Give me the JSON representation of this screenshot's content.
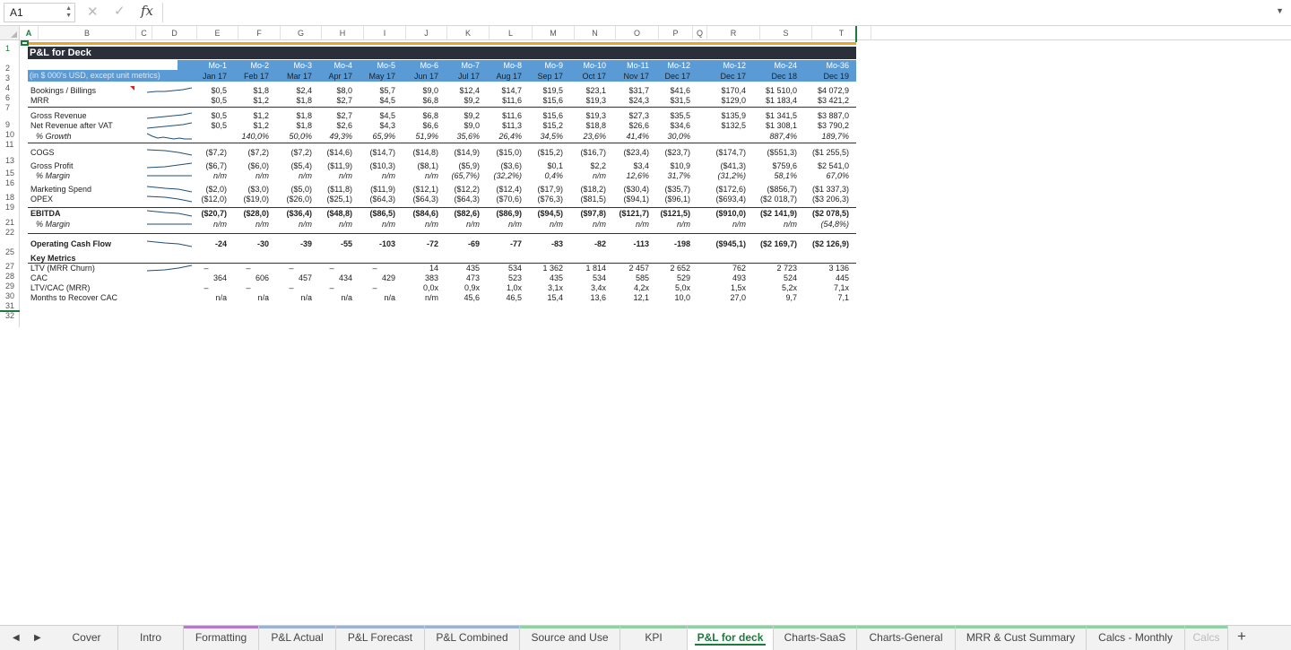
{
  "formula_bar": {
    "cell_ref": "A1",
    "fx_label": "fx",
    "cancel_icon": "✕",
    "enter_icon": "✓",
    "value": ""
  },
  "columns": [
    {
      "label": "A",
      "sel": true
    },
    {
      "label": "B"
    },
    {
      "label": "C"
    },
    {
      "label": "D"
    },
    {
      "label": "E"
    },
    {
      "label": "F"
    },
    {
      "label": "G"
    },
    {
      "label": "H"
    },
    {
      "label": "I"
    },
    {
      "label": "J"
    },
    {
      "label": "K"
    },
    {
      "label": "L"
    },
    {
      "label": "M"
    },
    {
      "label": "N"
    },
    {
      "label": "O"
    },
    {
      "label": "P"
    },
    {
      "label": "Q"
    },
    {
      "label": "R"
    },
    {
      "label": "S"
    },
    {
      "label": "T"
    }
  ],
  "row_numbers": [
    "1",
    "2",
    "3",
    "4",
    "6",
    "7",
    "9",
    "10",
    "11",
    "13",
    "15",
    "16",
    "18",
    "19",
    "21",
    "22",
    "25",
    "27",
    "28",
    "29",
    "30",
    "31",
    "32"
  ],
  "sheet": {
    "title": "P&L for Deck",
    "units": "(in $ 000's USD, except unit metrics)",
    "month_labels": [
      "Mo-1",
      "Mo-2",
      "Mo-3",
      "Mo-4",
      "Mo-5",
      "Mo-6",
      "Mo-7",
      "Mo-8",
      "Mo-9",
      "Mo-10",
      "Mo-11",
      "Mo-12",
      "Mo-12",
      "Mo-24",
      "Mo-36"
    ],
    "date_labels": [
      "Jan 17",
      "Feb 17",
      "Mar 17",
      "Apr 17",
      "May 17",
      "Jun 17",
      "Jul 17",
      "Aug 17",
      "Sep 17",
      "Oct 17",
      "Nov 17",
      "Dec 17",
      "Dec 17",
      "Dec 18",
      "Dec 19"
    ],
    "rows": [
      {
        "label": "Bookings / Billings",
        "spark": true,
        "values": [
          "$0,5",
          "$1,8",
          "$2,4",
          "$8,0",
          "$5,7",
          "$9,0",
          "$12,4",
          "$14,7",
          "$19,5",
          "$23,1",
          "$31,7",
          "$41,6",
          "$170,4",
          "$1 510,0",
          "$4 072,9"
        ]
      },
      {
        "label": "MRR",
        "values": [
          "$0,5",
          "$1,2",
          "$1,8",
          "$2,7",
          "$4,5",
          "$6,8",
          "$9,2",
          "$11,6",
          "$15,6",
          "$19,3",
          "$24,3",
          "$31,5",
          "$129,0",
          "$1 183,4",
          "$3 421,2"
        ]
      },
      {
        "label": "Gross Revenue",
        "spark": true,
        "values": [
          "$0,5",
          "$1,2",
          "$1,8",
          "$2,7",
          "$4,5",
          "$6,8",
          "$9,2",
          "$11,6",
          "$15,6",
          "$19,3",
          "$27,3",
          "$35,5",
          "$135,9",
          "$1 341,5",
          "$3 887,0"
        ]
      },
      {
        "label": "Net Revenue after VAT",
        "spark": true,
        "values": [
          "$0,5",
          "$1,2",
          "$1,8",
          "$2,6",
          "$4,3",
          "$6,6",
          "$9,0",
          "$11,3",
          "$15,2",
          "$18,8",
          "$26,6",
          "$34,6",
          "$132,5",
          "$1 308,1",
          "$3 790,2"
        ]
      },
      {
        "label": "% Growth",
        "indent": true,
        "italic": true,
        "spark": true,
        "values": [
          "",
          "140,0%",
          "50,0%",
          "49,3%",
          "65,9%",
          "51,9%",
          "35,6%",
          "26,4%",
          "34,5%",
          "23,6%",
          "41,4%",
          "30,0%",
          "",
          "887,4%",
          "189,7%"
        ]
      },
      {
        "label": "COGS",
        "spark": true,
        "values": [
          "($7,2)",
          "($7,2)",
          "($7,2)",
          "($14,6)",
          "($14,7)",
          "($14,8)",
          "($14,9)",
          "($15,0)",
          "($15,2)",
          "($16,7)",
          "($23,4)",
          "($23,7)",
          "($174,7)",
          "($551,3)",
          "($1 255,5)"
        ]
      },
      {
        "label": "Gross Profit",
        "spark": true,
        "values": [
          "($6,7)",
          "($6,0)",
          "($5,4)",
          "($11,9)",
          "($10,3)",
          "($8,1)",
          "($5,9)",
          "($3,6)",
          "$0,1",
          "$2,2",
          "$3,4",
          "$10,9",
          "($41,3)",
          "$759,6",
          "$2 541,0"
        ]
      },
      {
        "label": "% Margin",
        "indent": true,
        "italic": true,
        "spark": true,
        "values": [
          "n/m",
          "n/m",
          "n/m",
          "n/m",
          "n/m",
          "n/m",
          "(65,7%)",
          "(32,2%)",
          "0,4%",
          "n/m",
          "12,6%",
          "31,7%",
          "(31,2%)",
          "58,1%",
          "67,0%"
        ]
      },
      {
        "label": "Marketing Spend",
        "spark": true,
        "values": [
          "($2,0)",
          "($3,0)",
          "($5,0)",
          "($11,8)",
          "($11,9)",
          "($12,1)",
          "($12,2)",
          "($12,4)",
          "($17,9)",
          "($18,2)",
          "($30,4)",
          "($35,7)",
          "($172,6)",
          "($856,7)",
          "($1 337,3)"
        ]
      },
      {
        "label": "OPEX",
        "spark": true,
        "values": [
          "($12,0)",
          "($19,0)",
          "($26,0)",
          "($25,1)",
          "($64,3)",
          "($64,3)",
          "($64,3)",
          "($70,6)",
          "($76,3)",
          "($81,5)",
          "($94,1)",
          "($96,1)",
          "($693,4)",
          "($2 018,7)",
          "($3 206,3)"
        ]
      },
      {
        "label": "EBITDA",
        "bold": true,
        "spark": true,
        "values": [
          "($20,7)",
          "($28,0)",
          "($36,4)",
          "($48,8)",
          "($86,5)",
          "($84,6)",
          "($82,6)",
          "($86,9)",
          "($94,5)",
          "($97,8)",
          "($121,7)",
          "($121,5)",
          "($910,0)",
          "($2 141,9)",
          "($2 078,5)"
        ]
      },
      {
        "label": "% Margin",
        "indent": true,
        "italic": true,
        "spark": true,
        "values": [
          "n/m",
          "n/m",
          "n/m",
          "n/m",
          "n/m",
          "n/m",
          "n/m",
          "n/m",
          "n/m",
          "n/m",
          "n/m",
          "n/m",
          "n/m",
          "n/m",
          "(54,8%)"
        ]
      },
      {
        "label": "Operating Cash Flow",
        "bold": true,
        "spark": true,
        "values": [
          "-24",
          "-30",
          "-39",
          "-55",
          "-103",
          "-72",
          "-69",
          "-77",
          "-83",
          "-82",
          "-113",
          "-198",
          "($945,1)",
          "($2 169,7)",
          "($2 126,9)"
        ]
      },
      {
        "label": "Key Metrics",
        "bold": true,
        "values": []
      },
      {
        "label": "LTV (MRR Churn)",
        "spark": true,
        "values": [
          "–",
          "–",
          "–",
          "–",
          "–",
          "14",
          "435",
          "534",
          "1 362",
          "1 814",
          "2 457",
          "2 652",
          "762",
          "2 723",
          "3 136"
        ]
      },
      {
        "label": "CAC",
        "values": [
          "364",
          "606",
          "457",
          "434",
          "429",
          "383",
          "473",
          "523",
          "435",
          "534",
          "585",
          "529",
          "493",
          "524",
          "445"
        ]
      },
      {
        "label": "LTV/CAC (MRR)",
        "values": [
          "–",
          "–",
          "–",
          "–",
          "–",
          "0,0x",
          "0,9x",
          "1,0x",
          "3,1x",
          "3,4x",
          "4,2x",
          "5,0x",
          "1,5x",
          "5,2x",
          "7,1x"
        ]
      },
      {
        "label": "Months to Recover CAC",
        "values": [
          "n/a",
          "n/a",
          "n/a",
          "n/a",
          "n/a",
          "n/m",
          "45,6",
          "46,5",
          "15,4",
          "13,6",
          "12,1",
          "10,0",
          "27,0",
          "9,7",
          "7,1"
        ]
      }
    ]
  },
  "tabs": [
    {
      "label": "Cover"
    },
    {
      "label": "Intro"
    },
    {
      "label": "Formatting",
      "color": "#b57ac9"
    },
    {
      "label": "P&L Actual",
      "color": "#9bb1d6"
    },
    {
      "label": "P&L Forecast",
      "color": "#9bb1d6"
    },
    {
      "label": "P&L Combined",
      "color": "#9bb1d6"
    },
    {
      "label": "Source and Use",
      "color": "#8fd1a4"
    },
    {
      "label": "KPI",
      "color": "#8fd1a4"
    },
    {
      "label": "P&L for deck",
      "color": "#8fd1a4",
      "active": true
    },
    {
      "label": "Charts-SaaS",
      "color": "#8fd1a4"
    },
    {
      "label": "Charts-General",
      "color": "#8fd1a4"
    },
    {
      "label": "MRR & Cust Summary",
      "color": "#8fd1a4"
    },
    {
      "label": "Calcs - Monthly",
      "color": "#8fd1a4"
    },
    {
      "label": "Calcs",
      "color": "#8fd1a4"
    }
  ],
  "colors": {
    "title_band": "#2b2f3a",
    "header_band": "#5b9bd5",
    "accent_gold": "#e8a528",
    "active_green": "#1c7a3c"
  },
  "icons": {
    "fx": "function-icon",
    "cancel": "cancel-icon",
    "enter": "confirm-icon",
    "add": "plus-icon"
  }
}
